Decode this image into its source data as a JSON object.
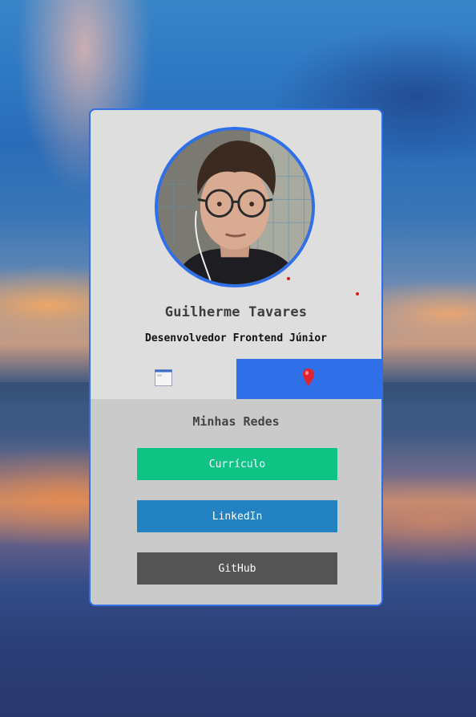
{
  "profile": {
    "name": "Guilherme Tavares",
    "role": "Desenvolvedor Frontend Júnior",
    "avatar_alt": "Foto de perfil"
  },
  "tabs": [
    {
      "icon": "browser-window-icon",
      "active": false
    },
    {
      "icon": "map-pin-icon",
      "active": true
    }
  ],
  "social": {
    "title": "Minhas Redes",
    "links": [
      {
        "label": "Currículo",
        "color": "#0ec383"
      },
      {
        "label": "LinkedIn",
        "color": "#2383c2"
      },
      {
        "label": "GitHub",
        "color": "#545454"
      }
    ]
  },
  "colors": {
    "accent": "#2f6fe8",
    "card_background": "#dedede",
    "lower_background": "#cacaca"
  }
}
